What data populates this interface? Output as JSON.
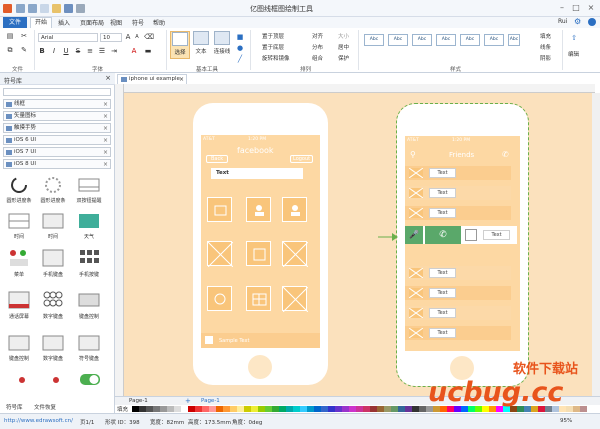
{
  "window": {
    "title": "亿图线框图绘制工具",
    "user": "Rui"
  },
  "menu": {
    "file": "文件",
    "items": [
      "开始",
      "插入",
      "页面布局",
      "视图",
      "符号",
      "帮助"
    ]
  },
  "ribbon": {
    "font_name": "Arial",
    "font_size": "10",
    "groups": {
      "file": "文件",
      "font": "字体",
      "basic_tools": "基本工具",
      "arrange": "排列",
      "style": "样式",
      "edit": "编辑"
    },
    "tools": {
      "select": "选择",
      "text": "文本",
      "connector": "连接线"
    },
    "arrange_labels": [
      "置于顶层",
      "置于底层",
      "旋转和镜像",
      "对齐",
      "分布",
      "大小",
      "居中",
      "组合",
      "保护"
    ],
    "style_sample": "Abc",
    "fill": "填充",
    "line": "线条",
    "shadow": "阴影",
    "edit_label": "编辑"
  },
  "library": {
    "title": "符号库",
    "categories": [
      "线框",
      "矢量图标",
      "触摸手势",
      "iOS 6 UI",
      "iOS 7 UI",
      "iOS 8 UI"
    ],
    "shapes": [
      [
        "圆形进度条",
        "圆形进度条",
        "双按钮提醒"
      ],
      [
        "时间",
        "时间",
        "天气"
      ],
      [
        "菜单",
        "手机键盘",
        "手机按键"
      ],
      [
        "通话屏幕",
        "数字键盘",
        "键盘控制"
      ],
      [
        "键盘控制",
        "数字键盘",
        "符号键盘"
      ]
    ],
    "tabs": [
      "符号库",
      "文件恢复"
    ]
  },
  "document": {
    "tab": "iphone ui example"
  },
  "phone_left": {
    "carrier": "AT&T",
    "time": "1:20 PM",
    "title": "facebook",
    "back": "Back",
    "logout": "Logout",
    "search_text": "Text",
    "footer_text": "Sample Text"
  },
  "phone_right": {
    "carrier": "AT&T",
    "time": "1:20 PM",
    "title": "Friends",
    "row_text": "Text",
    "rows": 9
  },
  "pages": {
    "nav": "Page-1",
    "active": "Page-1"
  },
  "fill_label": "填充",
  "status": {
    "url": "http://www.edrawsoft.cn/",
    "page": "页1/1",
    "shape_id": "形状 ID：398",
    "width": "宽度：82mm",
    "height": "高度：173.5mm",
    "angle": "角度：0deg",
    "zoom": "95%"
  },
  "watermark": {
    "cn": "软件下载站",
    "en": "ucbug.cc"
  },
  "colors": {
    "accent": "#2b6fc2",
    "canvas": "#fbe1bd",
    "phone_screen": "#fdd8a3",
    "tile": "#f9c57b",
    "highlight_row": "#5aa86a"
  }
}
